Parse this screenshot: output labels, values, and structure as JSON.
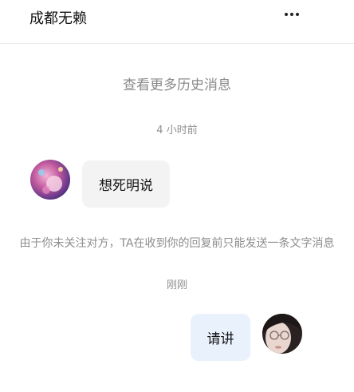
{
  "header": {
    "title": "成都无赖",
    "more_icon": "more-horizontal-icon"
  },
  "history_link": "查看更多历史消息",
  "messages": [
    {
      "time": "4 小时前",
      "direction": "incoming",
      "text": "想死明说"
    },
    {
      "notice": "由于你未关注对方，TA在收到你的回复前只能发送一条文字消息"
    },
    {
      "time": "刚刚",
      "direction": "outgoing",
      "text": "请讲"
    }
  ],
  "colors": {
    "incoming_bubble": "#f3f3f3",
    "outgoing_bubble": "#e9f1fd",
    "secondary_text": "#8d8d8d"
  }
}
